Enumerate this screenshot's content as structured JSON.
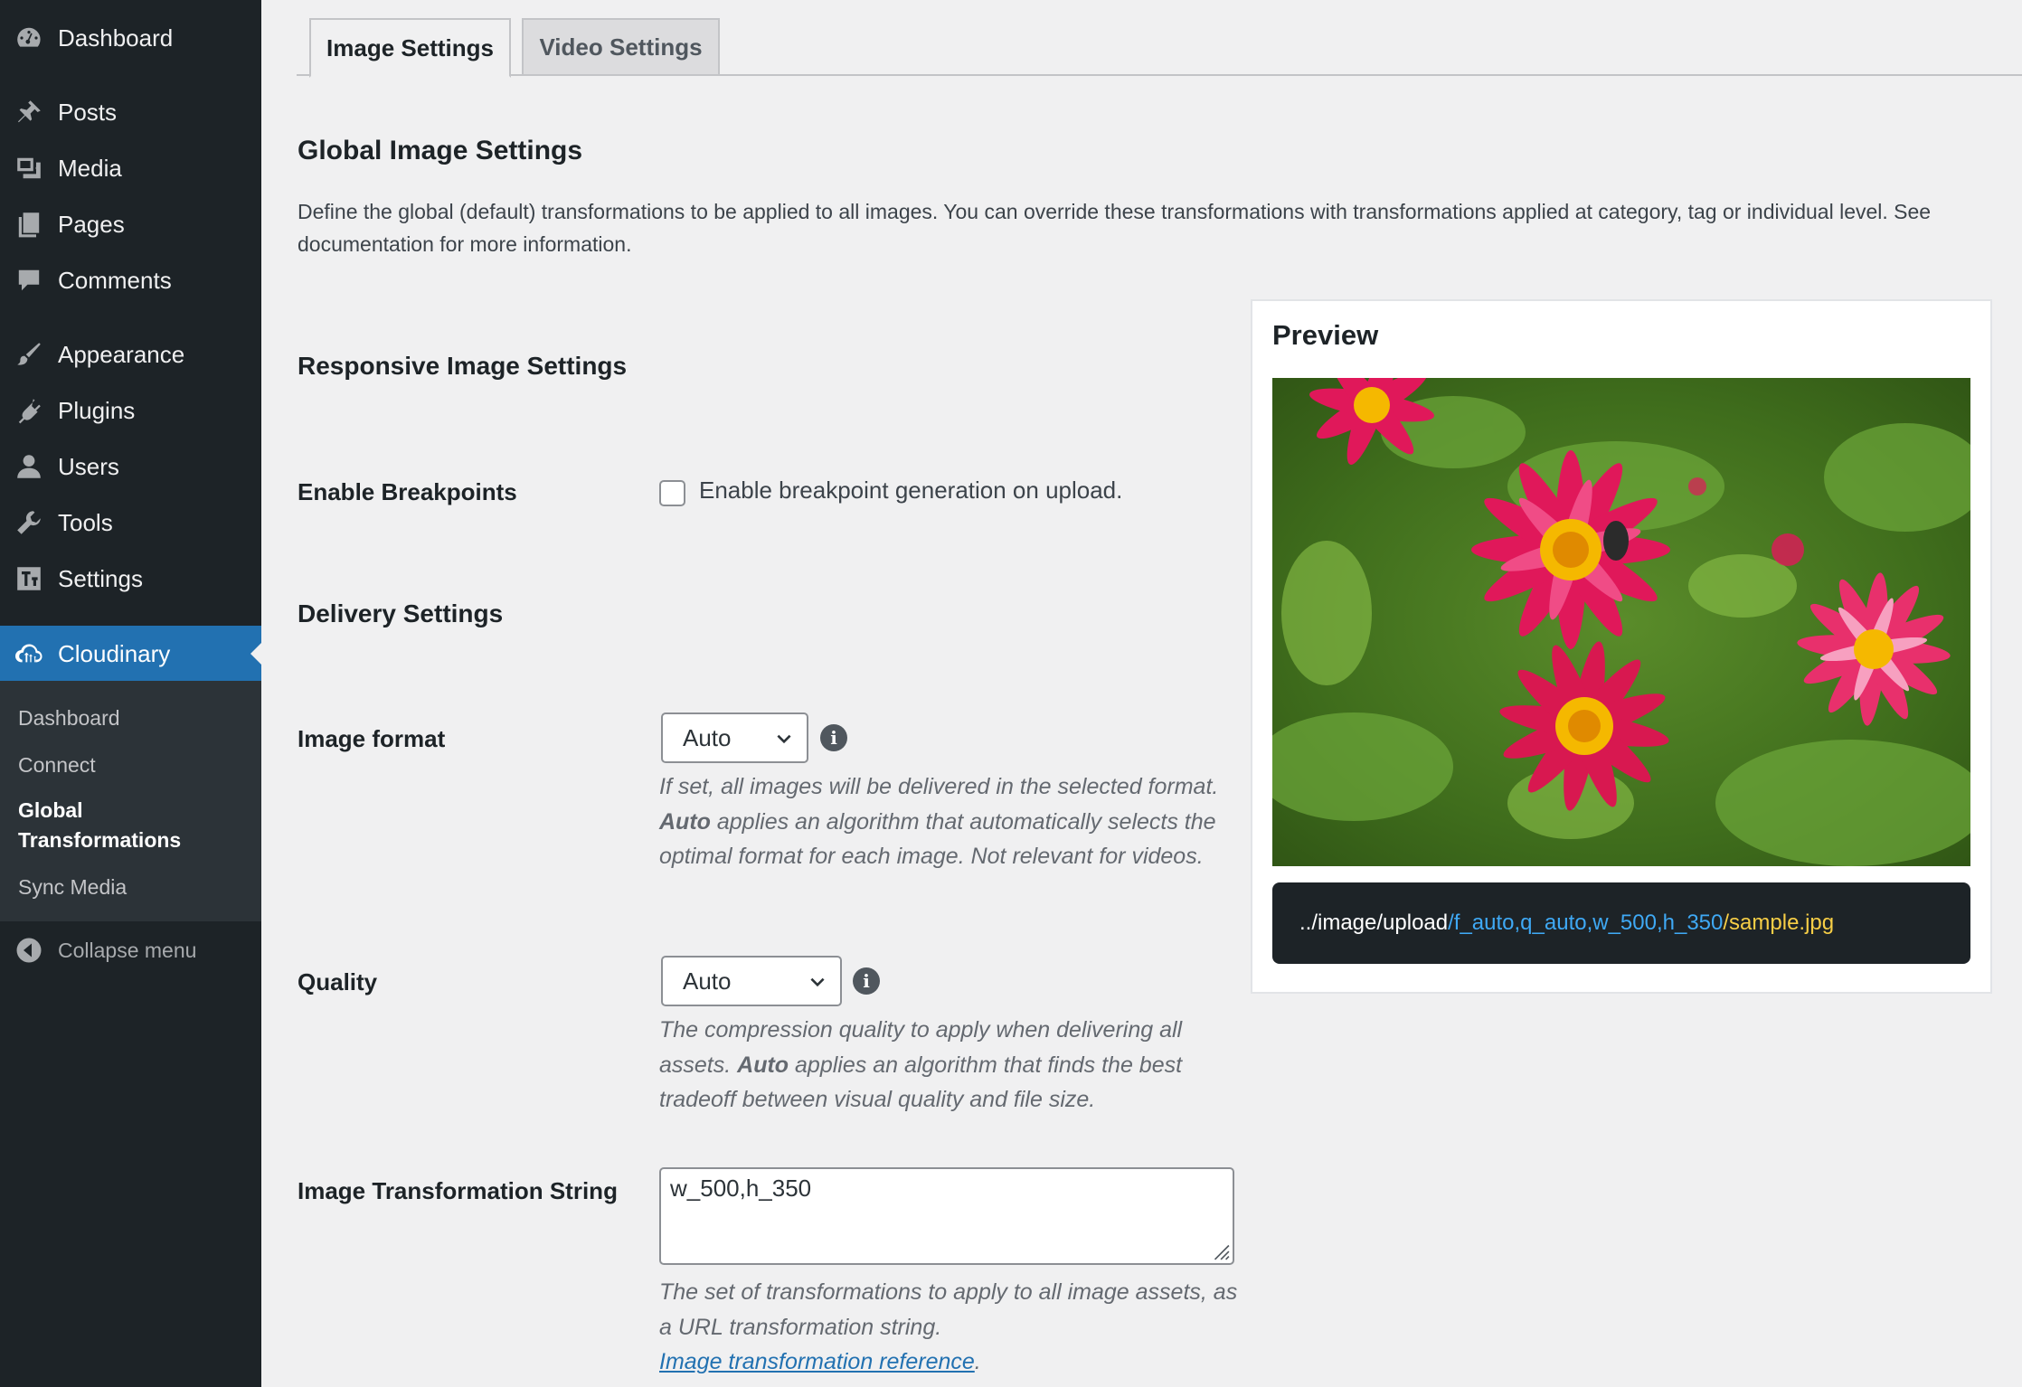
{
  "sidebar": {
    "items": [
      {
        "label": "Dashboard",
        "icon": "dashboard-icon"
      },
      {
        "label": "Posts",
        "icon": "pin-icon"
      },
      {
        "label": "Media",
        "icon": "media-icon"
      },
      {
        "label": "Pages",
        "icon": "pages-icon"
      },
      {
        "label": "Comments",
        "icon": "comment-icon"
      },
      {
        "label": "Appearance",
        "icon": "brush-icon"
      },
      {
        "label": "Plugins",
        "icon": "plug-icon"
      },
      {
        "label": "Users",
        "icon": "user-icon"
      },
      {
        "label": "Tools",
        "icon": "wrench-icon"
      },
      {
        "label": "Settings",
        "icon": "settings-icon"
      },
      {
        "label": "Cloudinary",
        "icon": "cloud-icon"
      }
    ],
    "submenu": [
      "Dashboard",
      "Connect",
      "Global Transformations",
      "Sync Media"
    ],
    "collapse": "Collapse menu"
  },
  "tabs": [
    "Image Settings",
    "Video Settings"
  ],
  "main": {
    "title": "Global Image Settings",
    "description": "Define the global (default) transformations to be applied to all images. You can override these transformations with transformations applied at category, tag or individual level. See documentation for more information.",
    "responsive_heading": "Responsive Image Settings",
    "breakpoints_label": "Enable Breakpoints",
    "breakpoints_checkbox": "Enable breakpoint generation on upload.",
    "delivery_heading": "Delivery Settings",
    "format_label": "Image format",
    "format_value": "Auto",
    "format_help": {
      "p1": "If set, all images will be delivered in the selected format. ",
      "bold": "Auto",
      "p2": " applies an algorithm that automatically selects the optimal format for each image. Not relevant for videos."
    },
    "quality_label": "Quality",
    "quality_value": "Auto",
    "quality_help": {
      "p1": "The compression quality to apply when delivering all assets. ",
      "bold": "Auto",
      "p2": " applies an algorithm that finds the best tradeoff between visual quality and file size."
    },
    "transform_label": "Image Transformation String",
    "transform_value": "w_500,h_350",
    "transform_help": "The set of transformations to apply to all image assets, as a URL transformation string.",
    "transform_link": "Image transformation reference",
    "transform_link_after": "."
  },
  "preview": {
    "title": "Preview",
    "url_base": "../image/upload",
    "url_trans": "/f_auto,q_auto,w_500,h_350",
    "url_file": "/sample.jpg"
  },
  "colors": {
    "sidebar_bg": "#1d2327",
    "active": "#2271b1",
    "url_transform": "#3fa9f5",
    "url_file": "#f7ce46"
  }
}
